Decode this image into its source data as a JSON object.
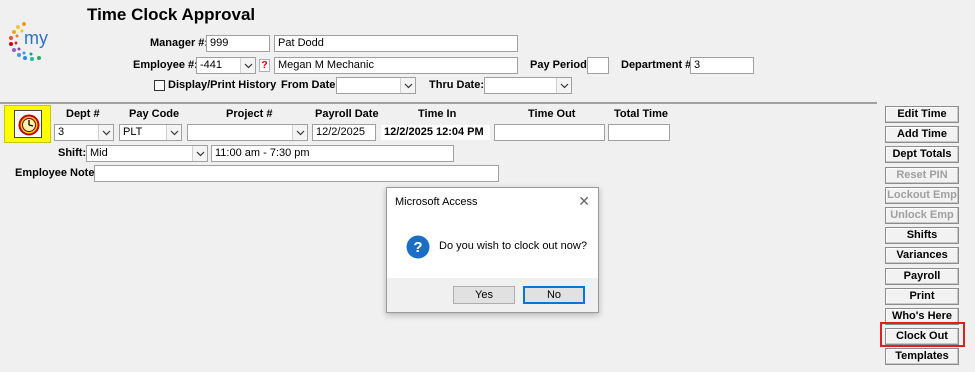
{
  "app_title": "Time Clock Approval",
  "logo_text": "my",
  "manager": {
    "label": "Manager #:",
    "number": "999",
    "name": "Pat Dodd"
  },
  "employee": {
    "label": "Employee #:",
    "number": "-441",
    "help": "?",
    "name": "Megan M Mechanic"
  },
  "pay_period": {
    "label": "Pay Period:",
    "value": ""
  },
  "department": {
    "label": "Department #:",
    "value": "3"
  },
  "history": {
    "label": "Display/Print History",
    "checked": false
  },
  "from_date": {
    "label": "From Date:",
    "value": ""
  },
  "thru_date": {
    "label": "Thru Date:",
    "value": ""
  },
  "columns": {
    "dept": "Dept #",
    "pay_code": "Pay Code",
    "project": "Project #",
    "payroll_date": "Payroll Date",
    "time_in": "Time In",
    "time_out": "Time Out",
    "total_time": "Total Time"
  },
  "row": {
    "dept": "3",
    "pay_code": "PLT",
    "project": "",
    "payroll_date": "12/2/2025",
    "time_in": "12/2/2025 12:04 PM",
    "time_out": "",
    "total_time": ""
  },
  "shift": {
    "label": "Shift:",
    "value": "Mid",
    "hours": "11:00 am - 7:30 pm"
  },
  "employee_note": {
    "label": "Employee Note:",
    "value": ""
  },
  "side_buttons": [
    {
      "label": "Edit Time",
      "enabled": true
    },
    {
      "label": "Add Time",
      "enabled": true
    },
    {
      "label": "Dept Totals",
      "enabled": true
    },
    {
      "label": "Reset PIN",
      "enabled": false
    },
    {
      "label": "Lockout Emp",
      "enabled": false
    },
    {
      "label": "Unlock Emp",
      "enabled": false
    },
    {
      "label": "Shifts",
      "enabled": true
    },
    {
      "label": "Variances",
      "enabled": true
    },
    {
      "label": "Payroll",
      "enabled": true
    },
    {
      "label": "Print",
      "enabled": true
    },
    {
      "label": "Who's Here",
      "enabled": true
    },
    {
      "label": "Clock Out",
      "enabled": true
    },
    {
      "label": "Templates",
      "enabled": true
    }
  ],
  "dialog": {
    "title": "Microsoft Access",
    "message": "Do you wish to clock out now?",
    "yes": "Yes",
    "no": "No"
  },
  "colors": {
    "highlight_yellow": "#ffff00",
    "highlight_red": "#e02020",
    "question_blue": "#1a6fc4"
  }
}
